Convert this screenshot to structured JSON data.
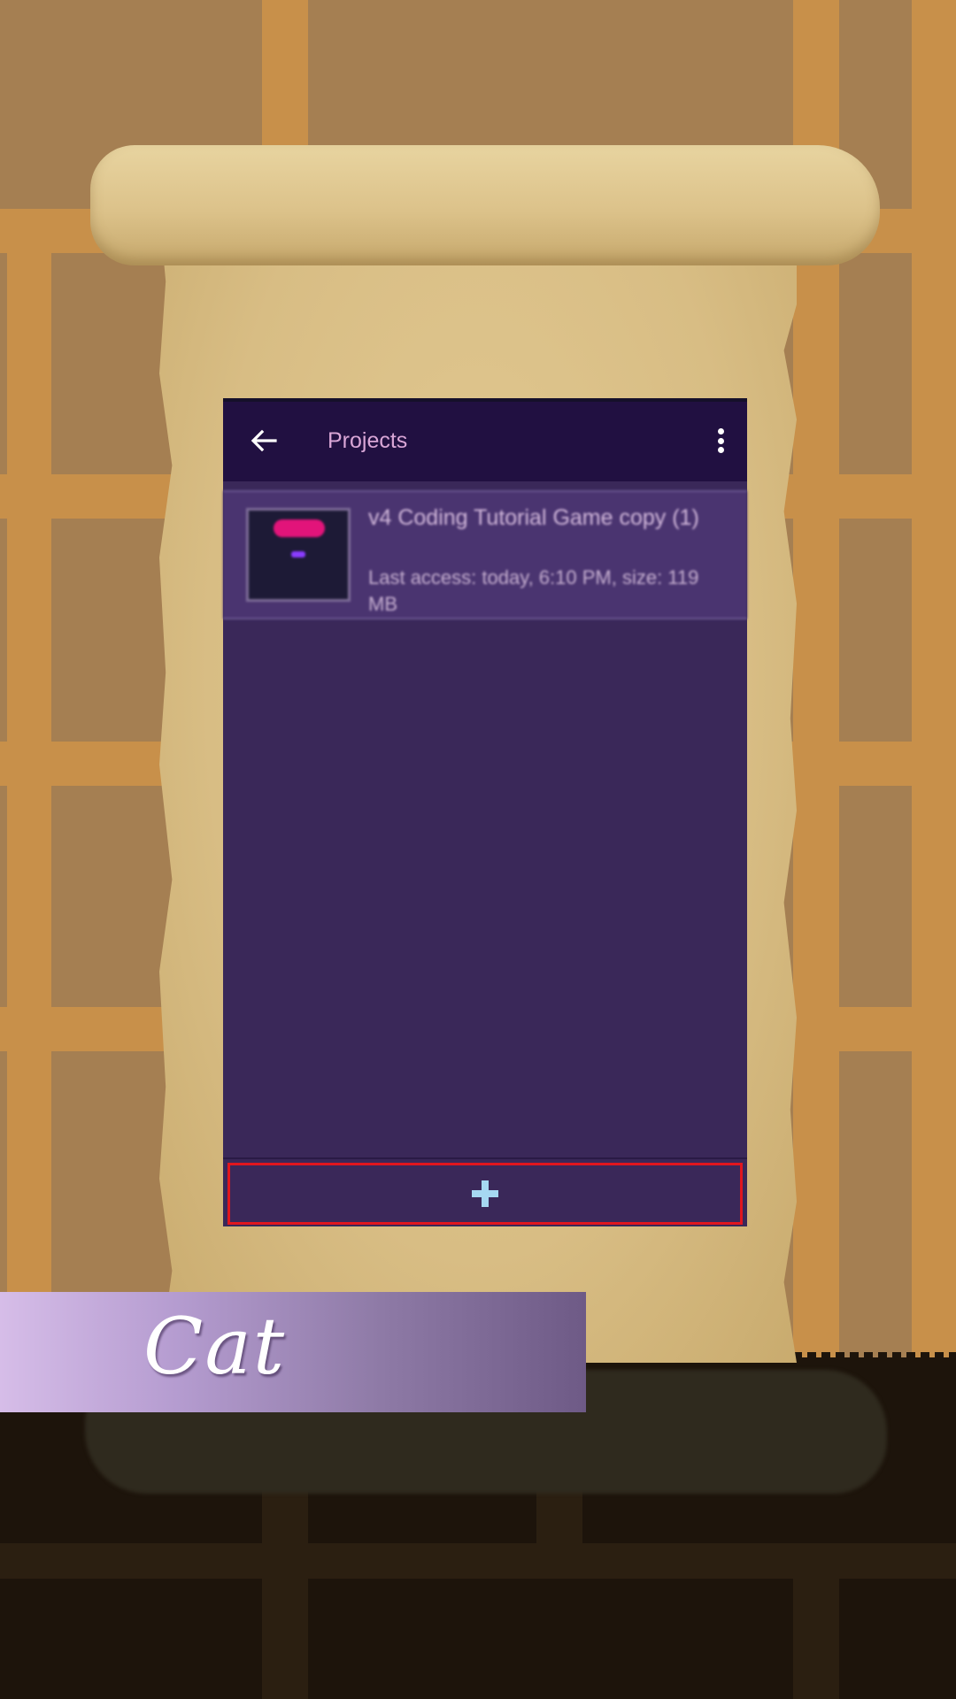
{
  "app_bar": {
    "title": "Projects",
    "back_icon": "arrow-left-icon",
    "menu_icon": "more-vert-icon"
  },
  "projects": [
    {
      "name": "v4 Coding Tutorial Game copy (1)",
      "details": "Last access: today, 6:10 PM, size: 119 MB"
    }
  ],
  "add_button": {
    "icon": "plus-icon"
  },
  "dialogue": {
    "speaker_name": "Cat"
  },
  "colors": {
    "app_bar_bg": "#211041",
    "list_bg": "#3a2859",
    "title_text": "#d9a6d6",
    "highlight_border": "#e0161e",
    "plus_icon": "#a6d8f2"
  }
}
